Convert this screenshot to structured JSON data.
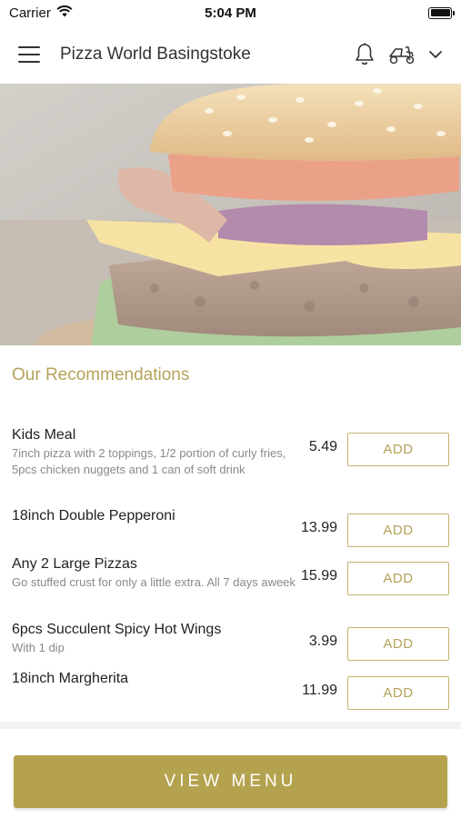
{
  "status_bar": {
    "carrier": "Carrier",
    "time": "5:04 PM"
  },
  "header": {
    "title": "Pizza World Basingstoke"
  },
  "recommendations": {
    "title": "Our Recommendations",
    "add_label": "ADD",
    "items": [
      {
        "name": "Kids Meal",
        "description": "7inch pizza with 2 toppings,  1/2 portion of curly fries, 5pcs chicken nuggets and 1 can of soft drink",
        "price": "5.49"
      },
      {
        "name": "18inch Double Pepperoni",
        "description": "",
        "price": "13.99"
      },
      {
        "name": "Any 2 Large Pizzas",
        "description": "Go stuffed crust for only a little extra. All 7 days aweek",
        "price": "15.99"
      },
      {
        "name": "6pcs Succulent Spicy Hot Wings",
        "description": "With 1 dip",
        "price": "3.99"
      },
      {
        "name": "18inch Margherita",
        "description": "",
        "price": "11.99"
      }
    ]
  },
  "view_menu_label": "VIEW MENU",
  "colors": {
    "accent": "#b5a24e",
    "accent_text": "#b5a25a"
  },
  "icons": [
    "wifi-icon",
    "battery-icon",
    "menu-icon",
    "bell-icon",
    "scooter-icon",
    "chevron-down-icon"
  ]
}
